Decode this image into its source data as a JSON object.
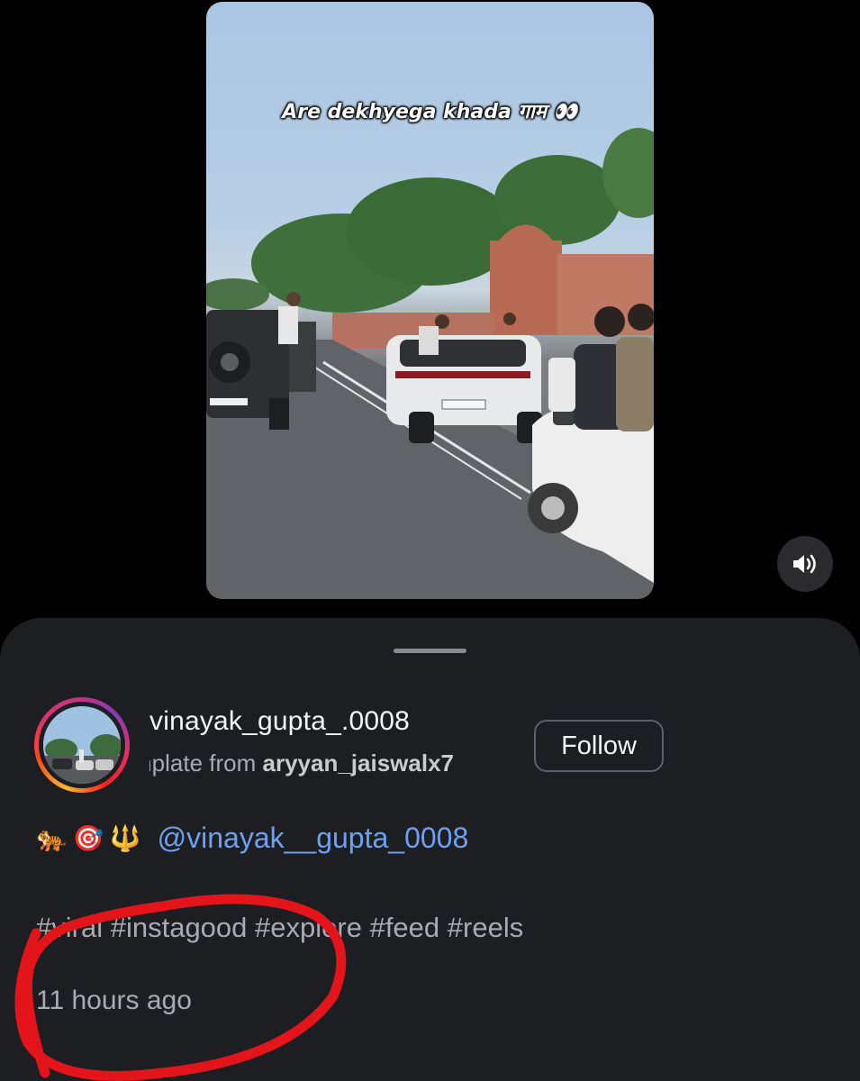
{
  "video": {
    "overlay_text": "Are dekhyega khada गाम 👀"
  },
  "controls": {
    "sound_icon": "speaker-volume-icon"
  },
  "post": {
    "username": "vinayak_gupta_.0008",
    "template_prefix": "mplate from ",
    "template_user": "aryyan_jaiswalx7",
    "follow_label": "Follow",
    "caption_emojis": [
      "🐅",
      "🎯",
      "🔱"
    ],
    "mention": "@vinayak__gupta_0008",
    "hashtags": [
      "#viral",
      "#instagood",
      "#explore",
      "#feed",
      "#reels"
    ],
    "timestamp": "11 hours ago"
  },
  "colors": {
    "sheet_background": "#1c1e22",
    "mention": "#6fa0f2",
    "annotation": "#e3151b"
  }
}
